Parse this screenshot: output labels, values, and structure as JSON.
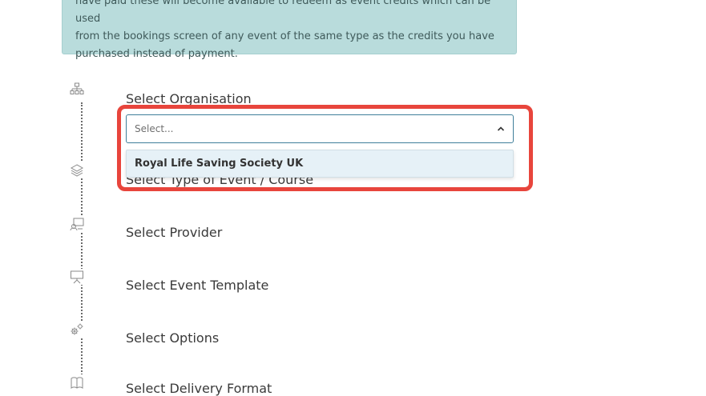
{
  "info": {
    "line1": "have paid these will become available to redeem as event credits which can be used",
    "line2": "from the bookings screen of any event of the same type as the credits you have",
    "line3": "purchased instead of payment."
  },
  "steps": [
    {
      "label": "Select Organisation",
      "icon": "organisation-hierarchy-icon"
    },
    {
      "label": "Select Type of Event / Course",
      "icon": "layers-icon"
    },
    {
      "label": "Select Provider",
      "icon": "provider-certificate-icon"
    },
    {
      "label": "Select Event Template",
      "icon": "presentation-board-icon"
    },
    {
      "label": "Select Options",
      "icon": "gears-icon"
    },
    {
      "label": "Select Delivery Format",
      "icon": "book-icon"
    }
  ],
  "organisation_select": {
    "placeholder": "Select...",
    "options": [
      "Royal Life Saving Society UK"
    ]
  },
  "colors": {
    "info_bg": "#b9dcdc",
    "highlight": "#e8453c",
    "select_border": "#3f7f9a",
    "option_bg": "#e6f1f7"
  }
}
